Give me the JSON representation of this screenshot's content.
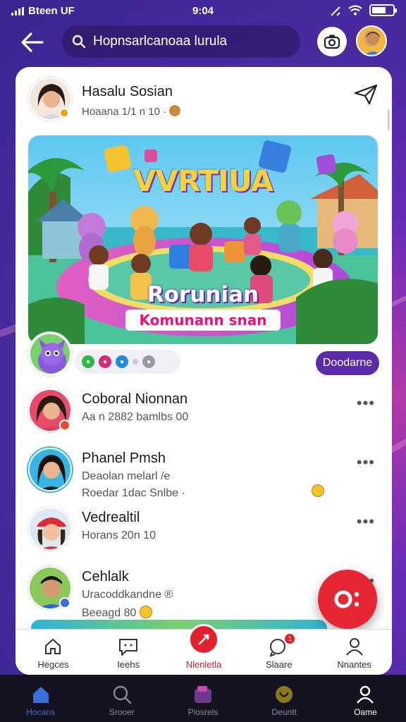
{
  "status": {
    "carrier": "Bteen UF",
    "time": "9:04"
  },
  "search": {
    "value": "Hopnsarlcanoaa lurula"
  },
  "post": {
    "author": "Hasalu Sosian",
    "meta": "Hoaana 1/1 n 10 ·",
    "image": {
      "title": "VVRTIUA",
      "banner_main": "Rorunian",
      "banner_sub": "Komunann snan"
    },
    "action_label": "Doodarne",
    "reactions": [
      "like",
      "love",
      "share",
      "more",
      "comment"
    ]
  },
  "comments": [
    {
      "name": "Coboral Nionnan",
      "line1": "Aa n 2882 bamlbs 00",
      "line2": ""
    },
    {
      "name": "Phanel Pmsh",
      "line1": "Deaolan melarl /e",
      "line2": "Roedar 1dac Snlbe ·"
    },
    {
      "name": "Vedrealtil",
      "line1": "Horans 20n 10",
      "line2": ""
    },
    {
      "name": "Cehlalk",
      "line1": "Uracoddkandne ®",
      "line2": "Beeagd 80"
    }
  ],
  "tabs": [
    {
      "label": "Hegces",
      "icon": "home-outline-icon"
    },
    {
      "label": "Ieehs",
      "icon": "chat-icon"
    },
    {
      "label": "Nlenletla",
      "icon": "create-icon"
    },
    {
      "label": "Slaare",
      "icon": "search-bubble-icon",
      "badge": "1"
    },
    {
      "label": "Nnantes",
      "icon": "profile-icon"
    }
  ],
  "nav": [
    {
      "label": "Hocans",
      "icon": "home-icon"
    },
    {
      "label": "Srooer",
      "icon": "search-icon"
    },
    {
      "label": "Piosrels",
      "icon": "photos-icon"
    },
    {
      "label": "Deuntt",
      "icon": "badge-icon"
    },
    {
      "label": "Oame",
      "icon": "account-icon"
    }
  ],
  "colors": {
    "accent": "#e62634",
    "purple": "#5a2aa8",
    "bg": "#4a2aa0"
  }
}
